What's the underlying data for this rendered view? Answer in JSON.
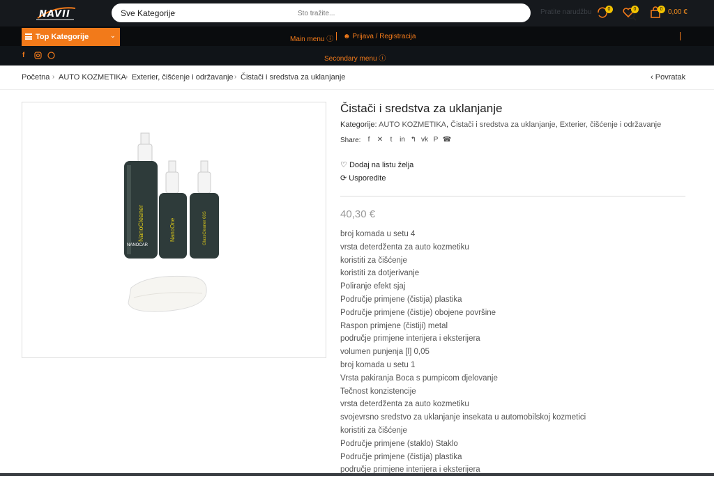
{
  "header": {
    "logo_text": "NAVII",
    "search": {
      "category_label": "Sve Kategorije",
      "placeholder": "Što tražite..."
    },
    "track_order": "Pratite narudžbu",
    "compare_count": "0",
    "wishlist_count": "0",
    "cart_count": "0",
    "cart_total": "0,00 €"
  },
  "nav": {
    "top_categories": "Top Kategorije",
    "main_menu": "Main menu",
    "login": "Prijava / Registracija",
    "secondary_menu": "Secondary menu"
  },
  "breadcrumb": {
    "items": [
      "Početna",
      "AUTO KOZMETIKA",
      "Exterier, čišćenje i održavanje",
      "Čistači i sredstva za uklanjanje"
    ],
    "back": "Povratak"
  },
  "product": {
    "title": "Čistači i sredstva za uklanjanje",
    "categories_label": "Kategorije:",
    "categories": [
      "AUTO KOZMETIKA",
      "Čistači i sredstva za uklanjanje",
      "Exterier, čišćenje i održavanje"
    ],
    "share_label": "Share:",
    "share_icons": [
      "facebook-icon",
      "x-icon",
      "tumblr-icon",
      "linkedin-icon",
      "odnoklassniki-icon",
      "vk-icon",
      "pinterest-icon",
      "whatsapp-icon"
    ],
    "wishlist_label": "Dodaj na listu želja",
    "compare_label": "Usporedite",
    "price": "40,30 €",
    "image_labels": [
      "NanoCleaner",
      "NanoOne",
      "GlassCleaner 60S",
      "NANOCAR"
    ],
    "description": [
      "broj komada u setu 4",
      "vrsta deterdženta za auto kozmetiku",
      "koristiti za čišćenje",
      "koristiti za dotjerivanje",
      "Poliranje efekt sjaj",
      "Područje primjene (čistija) plastika",
      "Područje primjene (čistije) obojene površine",
      "Raspon primjene (čistiji) metal",
      "područje primjene interijera i eksterijera",
      "volumen punjenja [l] 0,05",
      "broj komada u setu 1",
      "Vrsta pakiranja Boca s pumpicom djelovanje",
      "Tečnost konzistencije",
      "vrsta deterdženta za auto kozmetiku",
      "svojevrsno sredstvo za uklanjanje insekata u automobilskoj kozmetici",
      "koristiti za čišćenje",
      "Područje primjene (staklo) Staklo",
      "Područje primjene (čistija) plastika",
      "područje primjene interijera i eksterijera"
    ]
  },
  "colors": {
    "accent": "#f27a1a",
    "header_bg": "#16191d",
    "badge": "#f2c200"
  }
}
